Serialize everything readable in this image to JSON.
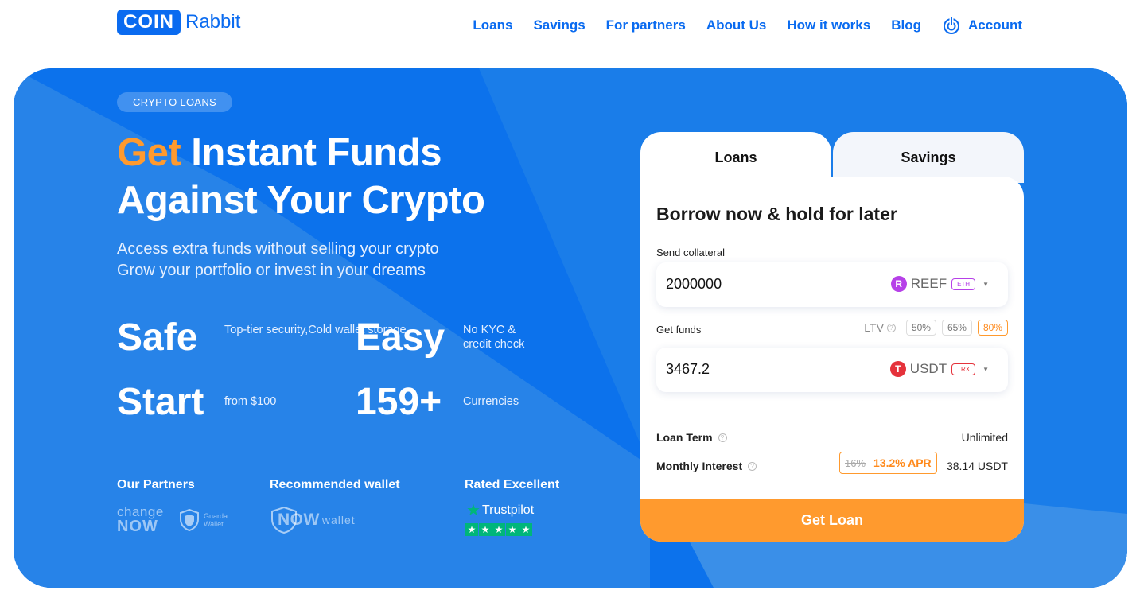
{
  "header": {
    "logo_box": "COIN",
    "logo_text": "Rabbit",
    "nav": [
      "Loans",
      "Savings",
      "For partners",
      "About Us",
      "How it works",
      "Blog"
    ],
    "account": "Account"
  },
  "hero": {
    "tag": "CRYPTO LOANS",
    "headline_accent": "Get",
    "headline_rest1": " Instant Funds",
    "headline_line2": "Against Your Crypto",
    "sub_line1": "Access extra funds without selling your crypto",
    "sub_line2": "Grow your portfolio or invest in your dreams",
    "stats": [
      {
        "big": "Safe",
        "small1": "Top-tier security,",
        "small2": "Cold wallet storage"
      },
      {
        "big": "Easy",
        "small1": "No KYC &",
        "small2": "credit check"
      },
      {
        "big": "Start",
        "small1": "from $100",
        "small2": ""
      },
      {
        "big": "159+",
        "small1": "Currencies",
        "small2": ""
      }
    ],
    "partners_title": "Our Partners",
    "partner_changenow_top": "change",
    "partner_changenow_bottom": "NOW",
    "partner_guarda_1": "Guarda",
    "partner_guarda_2": "Wallet",
    "wallet_title": "Recommended wallet",
    "wallet_now": "NOW",
    "wallet_word": "wallet",
    "rated_title": "Rated Excellent",
    "trustpilot": "Trustpilot"
  },
  "calculator": {
    "tabs": [
      "Loans",
      "Savings"
    ],
    "active_tab": "Loans",
    "title": "Borrow now & hold for later",
    "send_label": "Send collateral",
    "send_value": "2000000",
    "send_coin": "REEF",
    "send_network": "ETH",
    "get_label": "Get funds",
    "ltv_label": "LTV",
    "ltv_options": [
      "50%",
      "65%",
      "80%"
    ],
    "ltv_selected": "80%",
    "get_value": "3467.2",
    "get_coin": "USDT",
    "get_network": "TRX",
    "loan_term_label": "Loan Term",
    "loan_term_value": "Unlimited",
    "monthly_interest_label": "Monthly Interest",
    "old_rate": "16%",
    "new_rate": "13.2% APR",
    "monthly_interest_value": "38.14 USDT",
    "cta": "Get Loan"
  },
  "colors": {
    "brand_blue": "#0a6bf0",
    "accent_orange": "#ff9a2e",
    "reef_purple": "#b640e8",
    "usdt_red": "#e5323b",
    "trustpilot_green": "#00b67a"
  }
}
